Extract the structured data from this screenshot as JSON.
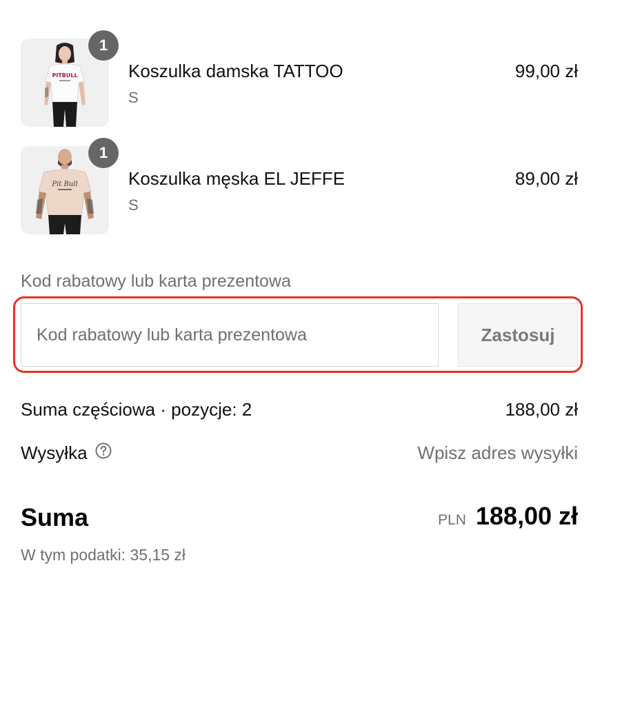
{
  "line_items": [
    {
      "quantity": "1",
      "title": "Koszulka damska TATTOO",
      "variant": "S",
      "price": "99,00 zł",
      "image_icon": "product-photo-woman-white-tshirt"
    },
    {
      "quantity": "1",
      "title": "Koszulka męska EL JEFFE",
      "variant": "S",
      "price": "89,00 zł",
      "image_icon": "product-photo-man-beige-tshirt"
    }
  ],
  "discount": {
    "label": "Kod rabatowy lub karta prezentowa",
    "placeholder": "Kod rabatowy lub karta prezentowa",
    "value": "",
    "apply_label": "Zastosuj",
    "highlight_color": "#e8321f"
  },
  "summary": {
    "subtotal_label": "Suma częściowa · pozycje: 2",
    "subtotal_value": "188,00 zł",
    "shipping_label": "Wysyłka",
    "shipping_icon": "question-circle-icon",
    "shipping_value": "Wpisz adres wysyłki",
    "total_label": "Suma",
    "currency": "PLN",
    "total_value": "188,00 zł",
    "tax_line": "W tym podatki: 35,15 zł"
  }
}
